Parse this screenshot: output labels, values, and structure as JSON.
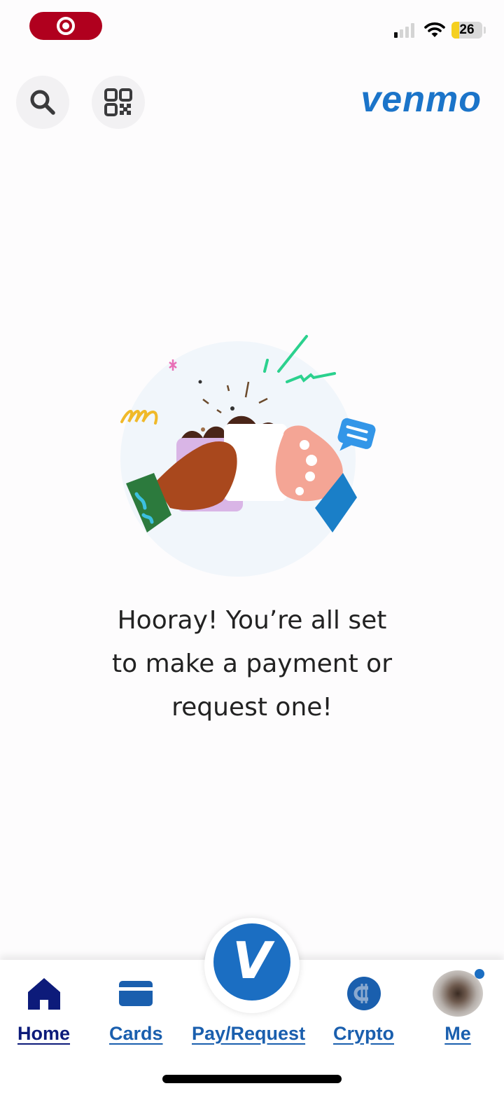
{
  "status_bar": {
    "battery_level": "26",
    "battery_fraction": 0.26,
    "signal_bars_active": 1,
    "signal_bars_total": 4,
    "icons": [
      "screen-record-icon",
      "cellular-signal-icon",
      "wifi-icon",
      "battery-icon"
    ]
  },
  "header": {
    "search_icon": "search-icon",
    "qr_icon": "qr-code-icon",
    "logo_text": "venmo",
    "brand_color": "#1b74c9"
  },
  "main": {
    "illustration": "two-hands-toasting-mugs-illustration",
    "message_lines": [
      "Hooray! You’re all set",
      "to make a payment or",
      "request one!"
    ]
  },
  "tabbar": {
    "tabs": [
      {
        "label": "Home",
        "icon": "home-icon",
        "active": true
      },
      {
        "label": "Cards",
        "icon": "card-icon",
        "active": false
      },
      {
        "label": "Pay/Request",
        "icon": "venmo-v-icon",
        "active": false
      },
      {
        "label": "Crypto",
        "icon": "crypto-icon",
        "active": false
      },
      {
        "label": "Me",
        "icon": "avatar",
        "active": false,
        "notification": true
      }
    ],
    "pay_glyph": "V",
    "active_color": "#0d1b7a",
    "inactive_color": "#1a5fae"
  }
}
